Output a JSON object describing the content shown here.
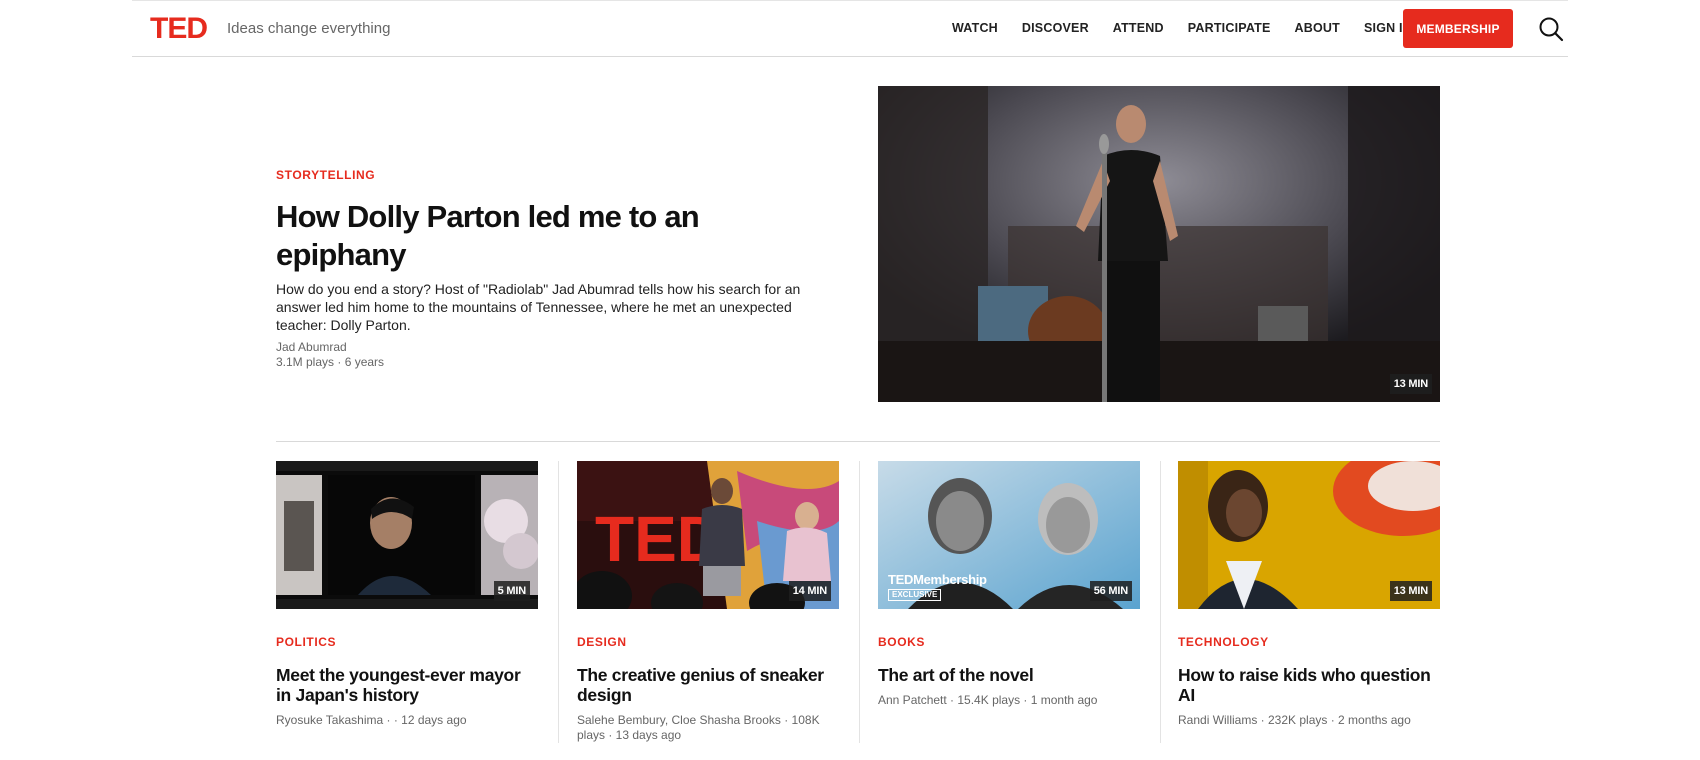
{
  "header": {
    "logo": "TED",
    "tagline": "Ideas change everything",
    "nav": [
      "WATCH",
      "DISCOVER",
      "ATTEND",
      "PARTICIPATE",
      "ABOUT",
      "SIGN IN"
    ],
    "membership_label": "MEMBERSHIP",
    "icons": {
      "search": "search-icon"
    },
    "colors": {
      "brand": "#e62b1e"
    }
  },
  "hero": {
    "category": "STORYTELLING",
    "title": "How Dolly Parton led me to an epiphany",
    "description": "How do you end a story? Host of \"Radiolab\" Jad Abumrad tells how his search for an answer led him home to the mountains of Tennessee, where he met an unexpected teacher: Dolly Parton.",
    "author": "Jad Abumrad",
    "stats": "3.1M plays · 6 years",
    "duration": "13 MIN"
  },
  "cards": [
    {
      "category": "POLITICS",
      "title": "Meet the youngest-ever mayor in Japan's history",
      "meta": "Ryosuke Takashima · · 12 days ago",
      "duration": "5 MIN"
    },
    {
      "category": "DESIGN",
      "title": "The creative genius of sneaker design",
      "meta": "Salehe Bembury, Cloe Shasha Brooks · 108K plays · 13 days ago",
      "duration": "14 MIN"
    },
    {
      "category": "BOOKS",
      "title": "The art of the novel",
      "meta": "Ann Patchett · 15.4K plays · 1 month ago",
      "duration": "56 MIN",
      "overlay_brand": "TEDMembership",
      "overlay_tag": "EXCLUSIVE"
    },
    {
      "category": "TECHNOLOGY",
      "title": "How to raise kids who question AI",
      "meta": "Randi Williams · 232K plays · 2 months ago",
      "duration": "13 MIN"
    }
  ]
}
